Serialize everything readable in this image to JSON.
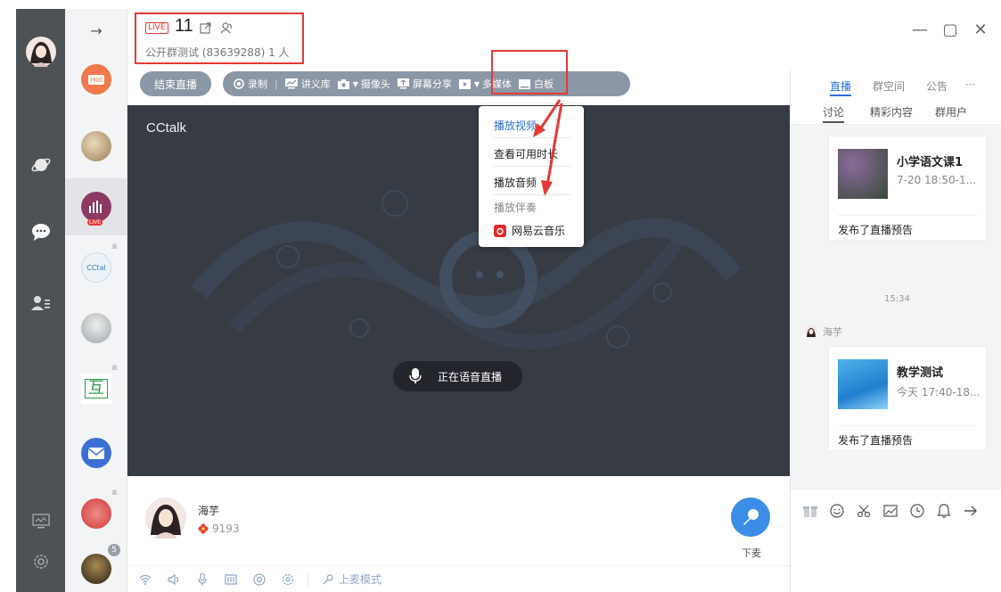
{
  "header": {
    "live_badge": "LIVE",
    "title": "11",
    "subtitle": "公开群测试 (83639288)   1 人"
  },
  "window_controls": {
    "minimize": "—",
    "maximize": "▢",
    "close": "✕"
  },
  "sidebar": {
    "collapse_arrow": "→",
    "items": [
      {
        "icon": "avatar-icon"
      },
      {
        "icon": "planet-icon"
      },
      {
        "icon": "chat-icon"
      },
      {
        "icon": "contacts-icon"
      },
      {
        "icon": "monitor-icon"
      },
      {
        "icon": "settings-icon"
      }
    ]
  },
  "group_list": {
    "hot_label": "Hot",
    "live_label": "LIVE",
    "cctalk_label": "CCtal",
    "hu_label": "互",
    "unread_count": "5"
  },
  "toolbar": {
    "end_live": "结束直播",
    "record": "录制",
    "lecture_library": "讲义库",
    "camera": "摄像头",
    "screen_share": "屏幕分享",
    "multimedia": "多媒体",
    "whiteboard": "白板"
  },
  "stage": {
    "logo": "CCtalk",
    "voice_status": "正在语音直播"
  },
  "dropdown": {
    "items": [
      "播放视频",
      "查看可用时长",
      "播放音频",
      "播放伴奏",
      "网易云音乐"
    ]
  },
  "speaker": {
    "name": "海芋",
    "flower_count": "9193",
    "mic_label": "下麦"
  },
  "bottombar": {
    "mode_label": "上麦模式"
  },
  "right_panel": {
    "tabs": [
      "直播",
      "群空间",
      "公告",
      "···"
    ],
    "subtabs": [
      "讨论",
      "精彩内容",
      "群用户"
    ],
    "cards": [
      {
        "title": "小学语文课1",
        "time": "7-20  18:50-1...",
        "footer": "发布了直播预告"
      },
      {
        "title": "教学测试",
        "time": "今天  17:40-18...",
        "footer": "发布了直播预告"
      }
    ],
    "timestamp": "15:34",
    "chat_user": "海芋"
  },
  "colors": {
    "accent_blue": "#2f6fd6",
    "highlight_red": "#e53935",
    "rail_dark": "#4d5257",
    "stage_bg": "#363b44"
  }
}
